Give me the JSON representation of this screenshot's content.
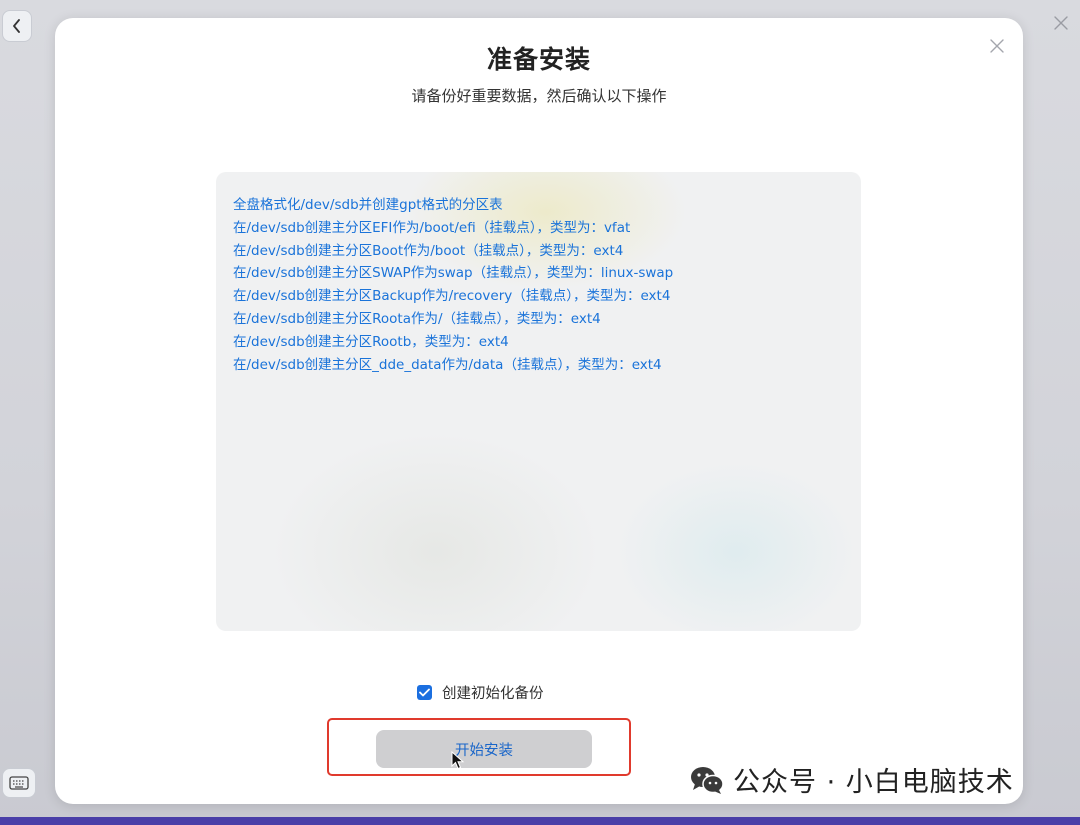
{
  "dialog": {
    "title": "准备安装",
    "subtitle": "请备份好重要数据，然后确认以下操作"
  },
  "operations": [
    "全盘格式化/dev/sdb并创建gpt格式的分区表",
    "在/dev/sdb创建主分区EFI作为/boot/efi（挂载点），类型为：vfat",
    "在/dev/sdb创建主分区Boot作为/boot（挂载点），类型为：ext4",
    "在/dev/sdb创建主分区SWAP作为swap（挂载点），类型为：linux-swap",
    "在/dev/sdb创建主分区Backup作为/recovery（挂载点），类型为：ext4",
    "在/dev/sdb创建主分区Roota作为/（挂载点），类型为：ext4",
    "在/dev/sdb创建主分区Rootb，类型为：ext4",
    "在/dev/sdb创建主分区_dde_data作为/data（挂载点），类型为：ext4"
  ],
  "backup": {
    "label": "创建初始化备份",
    "checked": true
  },
  "start_button": {
    "label": "开始安装"
  },
  "watermark": {
    "text": "公众号 · 小白电脑技术",
    "icon": "wechat-icon"
  },
  "colors": {
    "accent": "#1b6fe0",
    "link_text": "#1a73d9",
    "highlight": "#e03a2d"
  }
}
